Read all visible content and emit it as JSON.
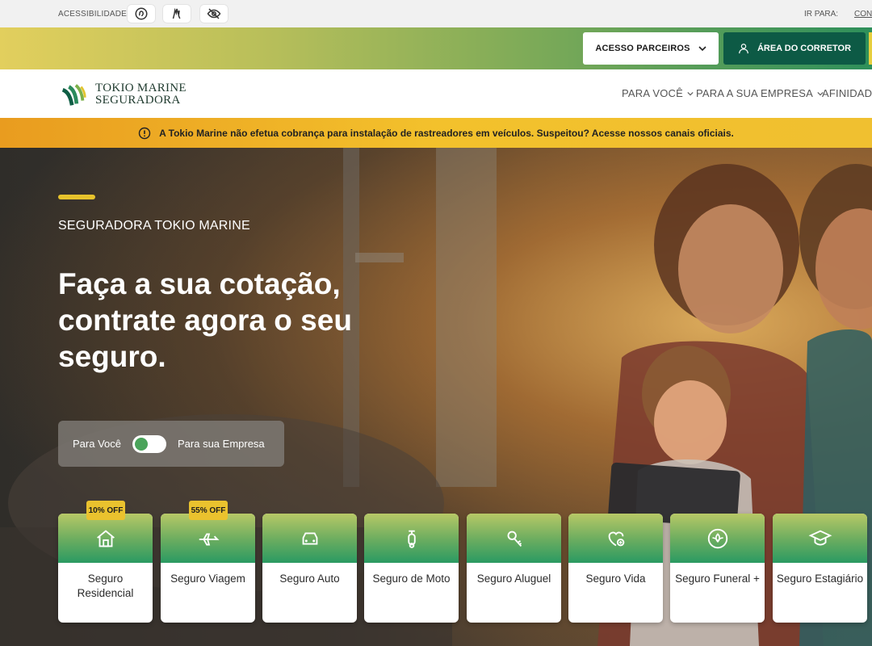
{
  "accessibility": {
    "label": "ACESSIBILIDADE",
    "ir_para": "IR PARA:",
    "conteudo_link": "CONTEÚDO"
  },
  "partner_bar": {
    "parceiros_label": "ACESSO PARCEIROS",
    "corretor_label": "ÁREA DO CORRETOR"
  },
  "logo": {
    "line1": "TOKIO MARINE",
    "line2": "SEGURADORA"
  },
  "nav": {
    "items": [
      "PARA VOCÊ",
      "PARA A SUA EMPRESA",
      "AFINIDADES"
    ]
  },
  "alert": {
    "text": "A Tokio Marine não efetua cobrança para instalação de rastreadores em veículos. Suspeitou? Acesse nossos canais oficiais."
  },
  "hero": {
    "kicker": "SEGURADORA TOKIO MARINE",
    "title": "Faça a sua cotação, contrate agora o seu seguro.",
    "toggle_left": "Para Você",
    "toggle_right": "Para sua Empresa"
  },
  "products": [
    {
      "label": "Seguro Residencial",
      "badge": "10% OFF",
      "icon": "house-icon"
    },
    {
      "label": "Seguro Viagem",
      "badge": "55% OFF",
      "icon": "airplane-icon"
    },
    {
      "label": "Seguro Auto",
      "badge": "",
      "icon": "car-icon"
    },
    {
      "label": "Seguro de Moto",
      "badge": "",
      "icon": "scooter-icon"
    },
    {
      "label": "Seguro Aluguel",
      "badge": "",
      "icon": "key-icon"
    },
    {
      "label": "Seguro Vida",
      "badge": "",
      "icon": "heart-plus-icon"
    },
    {
      "label": "Seguro Funeral +",
      "badge": "",
      "icon": "lotus-icon"
    },
    {
      "label": "Seguro Estagiário",
      "badge": "",
      "icon": "graduation-cap-icon"
    }
  ],
  "colors": {
    "brand_green": "#0d5a45",
    "accent_yellow": "#e7c32c",
    "alert_orange": "#e99c1f"
  }
}
